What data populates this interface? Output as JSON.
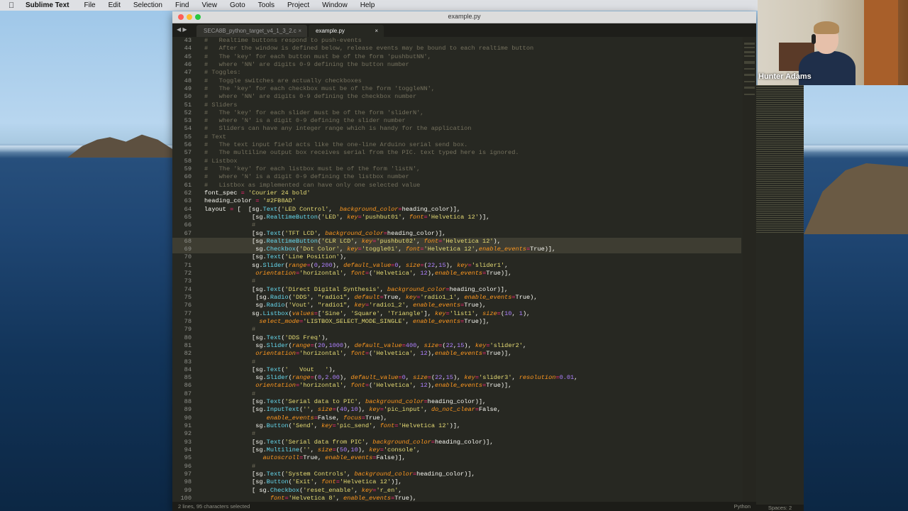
{
  "menubar": {
    "app_name": "Sublime Text",
    "items": [
      "File",
      "Edit",
      "Selection",
      "Find",
      "View",
      "Goto",
      "Tools",
      "Project",
      "Window",
      "Help"
    ]
  },
  "window": {
    "title": "example.py",
    "tabs": [
      {
        "label": "SECA8B_python_target_v4_1_3_2.c",
        "active": false
      },
      {
        "label": "example.py",
        "active": true
      }
    ]
  },
  "webcam": {
    "name": "Hunter Adams"
  },
  "status": {
    "selection": "2 lines, 95 characters selected",
    "spaces": "Spaces: 2",
    "syntax": "Python"
  },
  "code_lines": [
    {
      "n": "43",
      "t": "#   Realtime buttons respond to push-events"
    },
    {
      "n": "44",
      "t": "#   After the window is defined below, release events may be bound to each realtime button"
    },
    {
      "n": "45",
      "t": "#   The 'key' for each button must be of the form 'pushbutNN',"
    },
    {
      "n": "46",
      "t": "#   where 'NN' are digits 0-9 defining the button number"
    },
    {
      "n": "47",
      "t": "# Toggles:"
    },
    {
      "n": "48",
      "t": "#   Toggle switches are actually checkboxes"
    },
    {
      "n": "49",
      "t": "#   The 'key' for each checkbox must be of the form 'toggleNN',"
    },
    {
      "n": "50",
      "t": "#   where 'NN' are digits 0-9 defining the checkbox number"
    },
    {
      "n": "51",
      "t": "# Sliders"
    },
    {
      "n": "52",
      "t": "#   The 'key' for each slider must be of the form 'sliderN',"
    },
    {
      "n": "53",
      "t": "#   where 'N' is a digit 0-9 defining the slider number"
    },
    {
      "n": "54",
      "t": "#   Sliders can have any integer range which is handy for the application"
    },
    {
      "n": "55",
      "t": "# Text"
    },
    {
      "n": "56",
      "t": "#   The text input field acts like the one-line Arduino serial send box."
    },
    {
      "n": "57",
      "t": "#   The multiline output box receives serial from the PIC. text typed here is ignored."
    },
    {
      "n": "58",
      "t": "# Listbox"
    },
    {
      "n": "59",
      "t": "#   The 'key' for each listbox must be of the form 'listN',"
    },
    {
      "n": "60",
      "t": "#   where 'N' is a digit 0-9 defining the listbox number"
    },
    {
      "n": "61",
      "t": "#   Listbox as implemented can have only one selected value"
    },
    {
      "n": "62",
      "t": "font_spec = 'Courier 24 bold'"
    },
    {
      "n": "63",
      "t": "heading_color = '#2FB8AD'"
    },
    {
      "n": "64",
      "t": "layout = [  [sg.Text('LED Control',  background_color=heading_color)],"
    },
    {
      "n": "65",
      "t": "             [sg.RealtimeButton('LED', key='pushbut01', font='Helvetica 12')],"
    },
    {
      "n": "66",
      "t": "             #"
    },
    {
      "n": "67",
      "t": "             [sg.Text('TFT LCD', background_color=heading_color)],"
    },
    {
      "n": "68",
      "t": "             [sg.RealtimeButton('CLR LCD', key='pushbut02', font='Helvetica 12'),"
    },
    {
      "n": "69",
      "t": "              sg.Checkbox('Dot Color', key='toggle01', font='Helvetica 12',enable_events=True)],"
    },
    {
      "n": "70",
      "t": "             [sg.Text('Line Position'),"
    },
    {
      "n": "71",
      "t": "             sg.Slider(range=(0,200), default_value=0, size=(22,15), key='slider1',"
    },
    {
      "n": "72",
      "t": "              orientation='horizontal', font=('Helvetica', 12),enable_events=True)],"
    },
    {
      "n": "73",
      "t": "             #"
    },
    {
      "n": "74",
      "t": "             [sg.Text('Direct Digital Synthesis', background_color=heading_color)],"
    },
    {
      "n": "75",
      "t": "              [sg.Radio('DDS', \"radio1\", default=True, key='radio1_1', enable_events=True),"
    },
    {
      "n": "76",
      "t": "              sg.Radio('Vout', \"radio1\", key='radio1_2', enable_events=True),"
    },
    {
      "n": "77",
      "t": "             sg.Listbox(values=['Sine', 'Square', 'Triangle'], key='list1', size=(10, 1),"
    },
    {
      "n": "78",
      "t": "               select_mode='LISTBOX_SELECT_MODE_SINGLE', enable_events=True)],"
    },
    {
      "n": "79",
      "t": "             #"
    },
    {
      "n": "80",
      "t": "             [sg.Text('DDS Freq'),"
    },
    {
      "n": "81",
      "t": "              sg.Slider(range=(20,1000), default_value=400, size=(22,15), key='slider2',"
    },
    {
      "n": "82",
      "t": "              orientation='horizontal', font=('Helvetica', 12),enable_events=True)],"
    },
    {
      "n": "83",
      "t": "             #"
    },
    {
      "n": "84",
      "t": "             [sg.Text('   Vout   '),"
    },
    {
      "n": "85",
      "t": "              sg.Slider(range=(0,2.00), default_value=0, size=(22,15), key='slider3', resolution=0.01,"
    },
    {
      "n": "86",
      "t": "              orientation='horizontal', font=('Helvetica', 12),enable_events=True)],"
    },
    {
      "n": "87",
      "t": "             #"
    },
    {
      "n": "88",
      "t": "             [sg.Text('Serial data to PIC', background_color=heading_color)],"
    },
    {
      "n": "89",
      "t": "             [sg.InputText('', size=(40,10), key='pic_input', do_not_clear=False,"
    },
    {
      "n": "90",
      "t": "                 enable_events=False, focus=True),"
    },
    {
      "n": "91",
      "t": "              sg.Button('Send', key='pic_send', font='Helvetica 12')],"
    },
    {
      "n": "92",
      "t": "             #"
    },
    {
      "n": "93",
      "t": "             [sg.Text('Serial data from PIC', background_color=heading_color)],"
    },
    {
      "n": "94",
      "t": "             [sg.Multiline('', size=(50,10), key='console',"
    },
    {
      "n": "95",
      "t": "                autoscroll=True, enable_events=False)],"
    },
    {
      "n": "96",
      "t": "             #"
    },
    {
      "n": "97",
      "t": "             [sg.Text('System Controls', background_color=heading_color)],"
    },
    {
      "n": "98",
      "t": "             [sg.Button('Exit', font='Helvetica 12')],"
    },
    {
      "n": "99",
      "t": "             [ sg.Checkbox('reset_enable', key='r_en',"
    },
    {
      "n": "100",
      "t": "                  font='Helvetica 8', enable_events=True),"
    }
  ]
}
